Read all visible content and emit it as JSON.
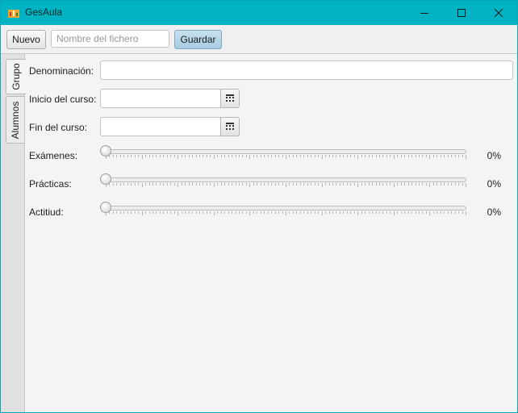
{
  "window": {
    "title": "GesAula",
    "icon": "app-chart-icon",
    "controls": [
      "minimize-icon",
      "maximize-icon",
      "close-icon"
    ]
  },
  "toolbar": {
    "new_label": "Nuevo",
    "filename_placeholder": "Nombre del fichero",
    "filename_value": "",
    "save_label": "Guardar"
  },
  "tabs": [
    {
      "label": "Grupo",
      "selected": true
    },
    {
      "label": "Alumnos",
      "selected": false
    }
  ],
  "form": {
    "denominacion": {
      "label": "Denominación:",
      "value": ""
    },
    "inicio": {
      "label": "Inicio del curso:",
      "value": "",
      "icon": "calendar-icon"
    },
    "fin": {
      "label": "Fin del curso:",
      "value": "",
      "icon": "calendar-icon"
    },
    "sliders": [
      {
        "label": "Exámenes:",
        "value": 0,
        "display": "0%"
      },
      {
        "label": "Prácticas:",
        "value": 0,
        "display": "0%"
      },
      {
        "label": "Actitiud:",
        "value": 0,
        "display": "0%"
      }
    ]
  },
  "colors": {
    "titlebar": "#00b3c2",
    "save_button": "#a5cce0"
  }
}
